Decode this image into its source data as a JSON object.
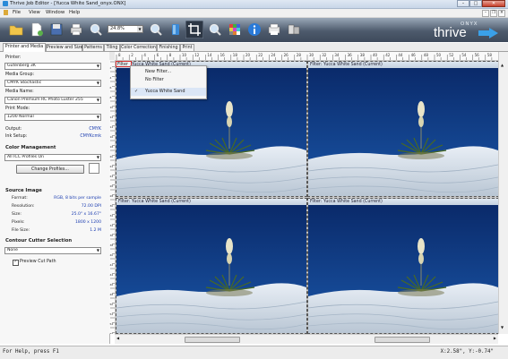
{
  "window": {
    "title": "Thrive Job Editor - [Yucca White Sand_onyx.ONX]",
    "controls": {
      "minimize": "–",
      "maximize": "□",
      "close": "✕"
    }
  },
  "menu": {
    "items": [
      "File",
      "View",
      "Window",
      "Help"
    ]
  },
  "mdi_controls": {
    "minimize": "–",
    "restore": "❐",
    "close": "✕"
  },
  "toolbar": {
    "zoom_value": "24.8%",
    "icons": [
      "folder-open-icon",
      "new-document-icon",
      "save-icon",
      "print-icon",
      "find-icon",
      "zoom-in-icon",
      "zoom-out-icon",
      "color-bar-icon",
      "crop-icon",
      "zoom-icon",
      "color-grid-icon",
      "info-icon",
      "print-queue-icon",
      "nest-icon"
    ]
  },
  "brand": {
    "small": "ONYX",
    "name": "thrive",
    "accent": "#3aa0e8"
  },
  "tabs": [
    "Printer and Media",
    "Preview and Size",
    "Patterns",
    "Tiling",
    "Color Correction",
    "Finishing",
    "Print"
  ],
  "active_tab": "Printer and Media",
  "left_panel": {
    "printer_label": "Printer:",
    "printer_value": "Gutenberg 3K",
    "media_group_label": "Media Group:",
    "media_group_value": "CMYK Stochastic",
    "media_name_label": "Media Name:",
    "media_name_value": "Canon Premium RC Photo Luster 255",
    "print_mode_label": "Print Mode:",
    "print_mode_value": "1200 Normal",
    "output_label": "Output:",
    "output_value": "CMYK",
    "ink_setup_label": "Ink Setup:",
    "ink_setup_value": "CMYKcmk",
    "color_mgmt_header": "Color Management",
    "color_mgmt_value": "All ICC Profiles On",
    "change_profiles_button": "Change Profiles...",
    "source_image_header": "Source Image",
    "format_label": "Format:",
    "format_value": "RGB, 8 bits per sample",
    "resolution_label": "Resolution:",
    "resolution_value": "72.00 DPI",
    "size_label": "Size:",
    "size_value": "25.0\" x 16.67\"",
    "pixels_label": "Pixels:",
    "pixels_value": "1800 x 1200",
    "filesize_label": "File Size:",
    "filesize_value": "1.2 M",
    "contour_header": "Contour Cutter Selection",
    "contour_value": "None",
    "preview_cut_label": "Preview Cut Path",
    "preview_cut_checked": true
  },
  "ruler_ticks": [
    "8",
    "2",
    "4",
    "6",
    "8",
    "10",
    "12",
    "14",
    "16",
    "18",
    "20",
    "22",
    "24",
    "26",
    "28",
    "30",
    "32",
    "34",
    "36",
    "38",
    "40",
    "42",
    "44",
    "46",
    "48",
    "50",
    "52",
    "54",
    "56",
    "58",
    "60"
  ],
  "ruler_left_ticks": [
    "2",
    "4",
    "6",
    "8",
    "10",
    "12",
    "14",
    "16",
    "18",
    "20",
    "22",
    "24",
    "26",
    "28",
    "30",
    "32",
    "34",
    "36",
    "38",
    "40",
    "42",
    "44",
    "46",
    "48",
    "50",
    "52",
    "54",
    "56"
  ],
  "panels": [
    {
      "title": "Filter: Yucca White Sand (Current)"
    },
    {
      "title": "Filter: Yucca White Sand (Current)"
    },
    {
      "title": "Filter: Yucca White Sand (Current)"
    },
    {
      "title": "Filter: Yucca White Sand (Current)"
    }
  ],
  "filter_button": "Filter",
  "popup_menu": {
    "items": [
      "New Filter...",
      "No Filter",
      "Yucca White Sand"
    ],
    "checked": "Yucca White Sand",
    "check_mark": "✓"
  },
  "status": {
    "help": "For Help, press F1",
    "coords": "X:2.58\", Y:-0.74\""
  }
}
